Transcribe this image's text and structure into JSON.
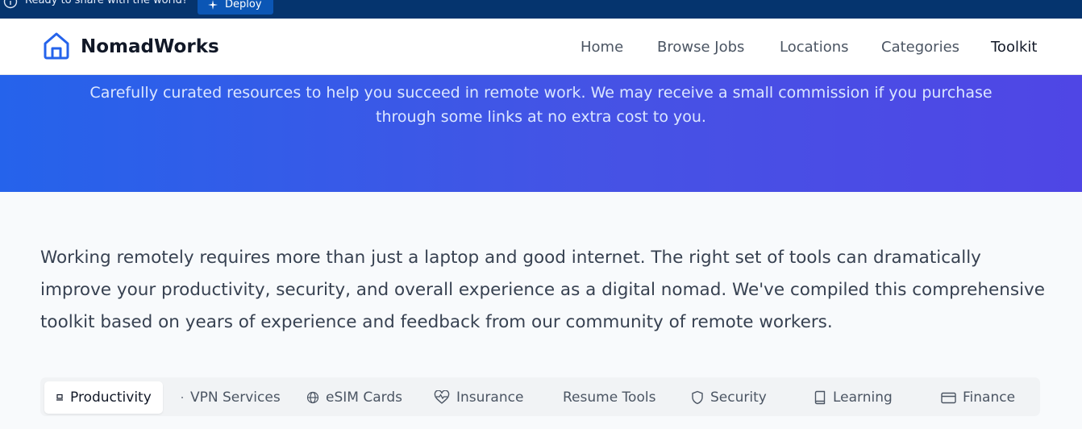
{
  "deploy_bar": {
    "message": "Ready to share with the world?",
    "button_label": "Deploy"
  },
  "header": {
    "brand": "NomadWorks",
    "nav": [
      {
        "label": "Home"
      },
      {
        "label": "Browse Jobs"
      },
      {
        "label": "Locations"
      },
      {
        "label": "Categories"
      },
      {
        "label": "Toolkit",
        "active": true
      }
    ]
  },
  "hero": {
    "subtitle": "Carefully curated resources to help you succeed in remote work. We may receive a small commission if you purchase through some links at no extra cost to you."
  },
  "intro": {
    "text": "Working remotely requires more than just a laptop and good internet. The right set of tools can dramatically improve your productivity, security, and overall experience as a digital nomad. We've compiled this comprehensive toolkit based on years of experience and feedback from our community of remote workers."
  },
  "tabs": [
    {
      "label": "Productivity",
      "icon": "laptop-icon",
      "active": true
    },
    {
      "label": "VPN Services",
      "icon": "dot-icon"
    },
    {
      "label": "eSIM Cards",
      "icon": "globe-icon"
    },
    {
      "label": "Insurance",
      "icon": "heart-pulse-icon"
    },
    {
      "label": "Resume Tools",
      "icon": "none"
    },
    {
      "label": "Security",
      "icon": "shield-icon"
    },
    {
      "label": "Learning",
      "icon": "book-icon"
    },
    {
      "label": "Finance",
      "icon": "credit-card-icon"
    }
  ],
  "colors": {
    "deploy_bar": "#05346e",
    "brand_blue": "#2563eb",
    "hero_end": "#4f46e5"
  }
}
